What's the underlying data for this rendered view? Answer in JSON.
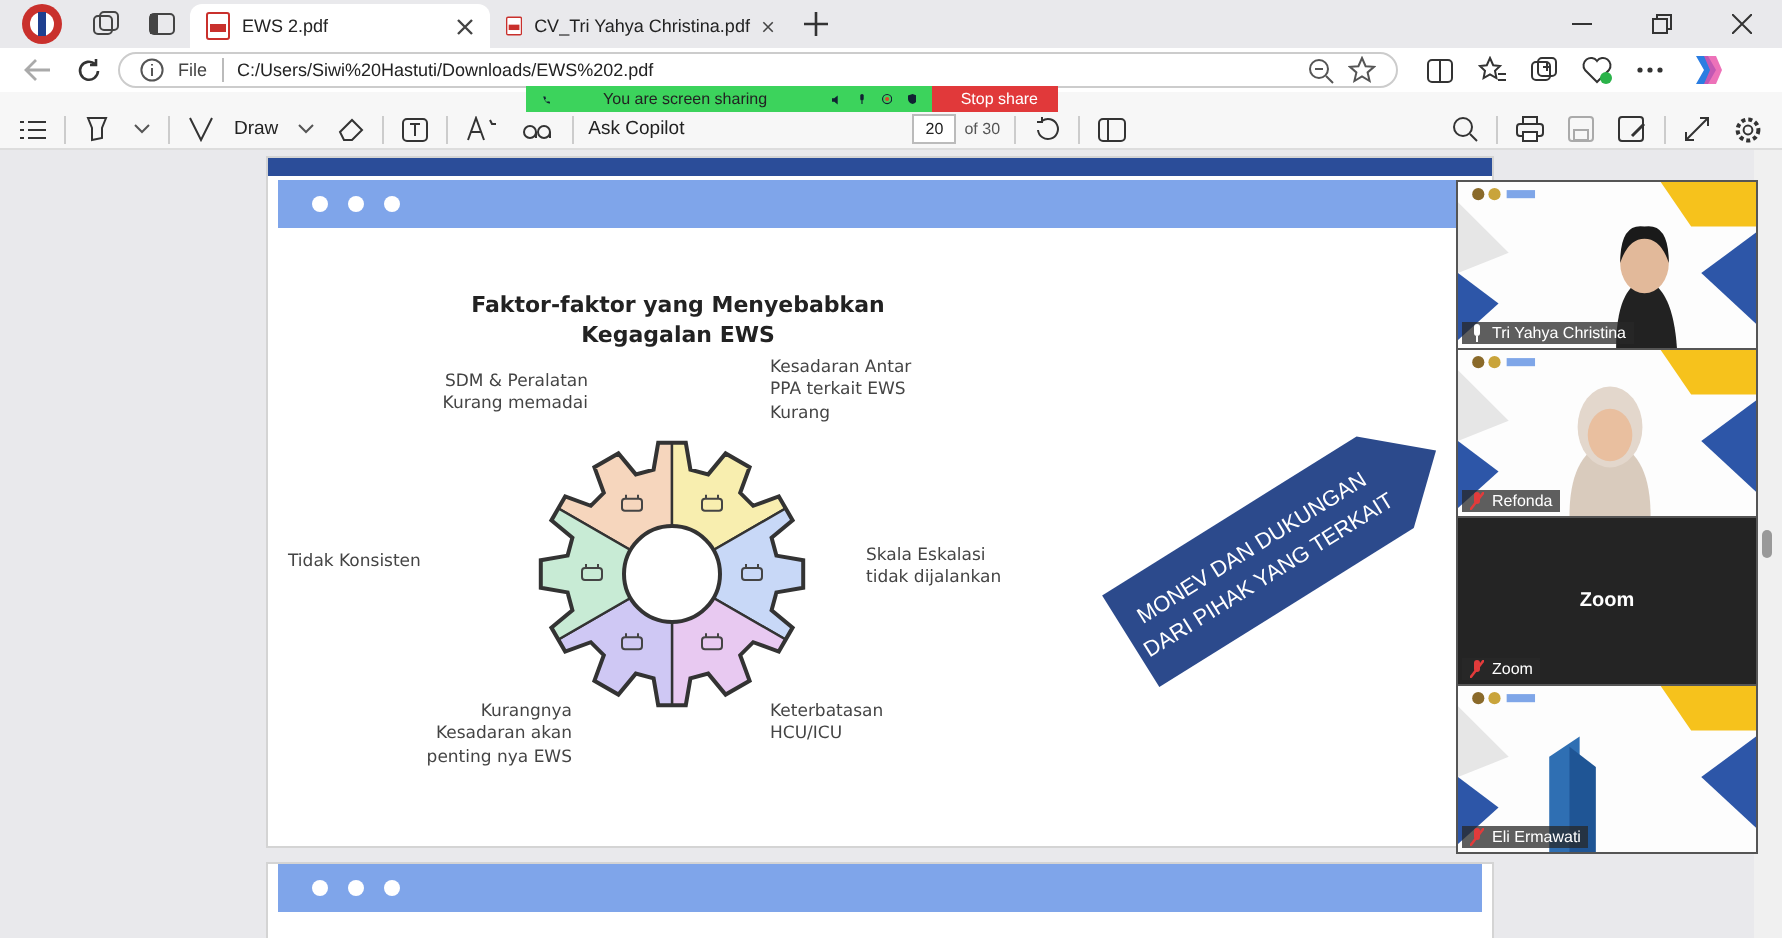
{
  "tabs": [
    {
      "label": "EWS 2.pdf",
      "selected": true
    },
    {
      "label": "CV_Tri Yahya Christina.pdf",
      "selected": false
    }
  ],
  "address": {
    "scheme": "File",
    "url": "C:/Users/Siwi%20Hastuti/Downloads/EWS%202.pdf"
  },
  "pdf_toolbar": {
    "draw": "Draw",
    "ask": "Ask Copilot",
    "page": "20",
    "of": "of 30"
  },
  "share_banner": {
    "status": "You are screen sharing",
    "stop": "Stop share"
  },
  "slide": {
    "title": "Faktor-faktor yang Menyebabkan\nKegagalan EWS",
    "factors": [
      {
        "text": "SDM & Peralatan\nKurang memadai"
      },
      {
        "text": "Kesadaran Antar\nPPA  terkait EWS\nKurang"
      },
      {
        "text": "Tidak Konsisten"
      },
      {
        "text": "Skala Eskalasi\ntidak dijalankan"
      },
      {
        "text": "Kurangnya\nKesadaran akan\npenting nya EWS"
      },
      {
        "text": "Keterbatasan\nHCU/ICU"
      }
    ],
    "banner": [
      "MONEV DAN DUKUNGAN",
      "DARI PIHAK YANG TERKAIT"
    ]
  },
  "participants": [
    {
      "name": "Tri Yahya Christina",
      "kind": "video",
      "muted": false
    },
    {
      "name": "Refonda",
      "kind": "video",
      "muted": true
    },
    {
      "name": "Zoom",
      "kind": "blank",
      "title": "Zoom",
      "muted": true
    },
    {
      "name": "Eli Ermawati",
      "kind": "video",
      "muted": true
    }
  ]
}
